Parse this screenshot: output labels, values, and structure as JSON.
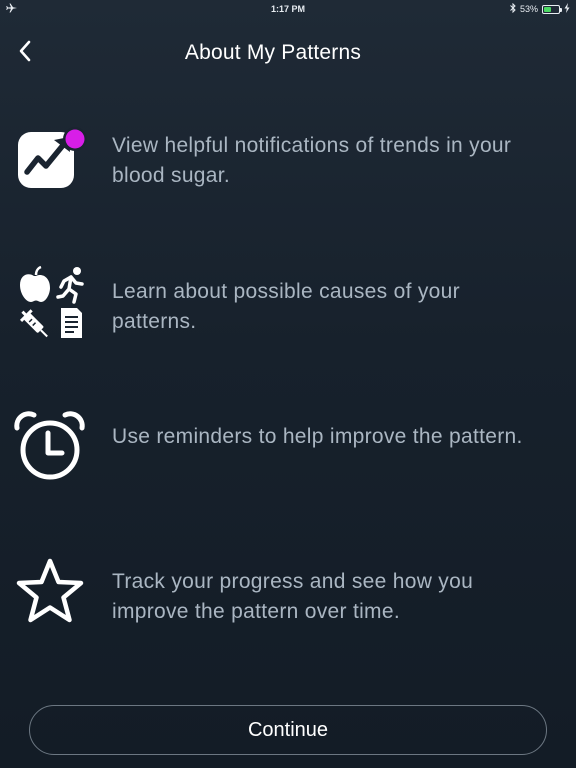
{
  "status_bar": {
    "time": "1:17 PM",
    "battery_percent": "53%",
    "battery_level": 0.53,
    "battery_color": "#4cd964"
  },
  "header": {
    "back_icon": "chevron-left-icon",
    "title": "About My Patterns"
  },
  "features": [
    {
      "icon": "trend-notification-icon",
      "text": "View helpful notifications of trends in your blood sugar.",
      "badge_color": "#d81ee8"
    },
    {
      "icon": "causes-icon",
      "text": "Learn about possible causes of your patterns."
    },
    {
      "icon": "alarm-clock-icon",
      "text": "Use reminders to help improve the pattern."
    },
    {
      "icon": "star-icon",
      "text": "Track your progress and see how you improve the pattern over time."
    }
  ],
  "footer": {
    "continue_label": "Continue"
  }
}
